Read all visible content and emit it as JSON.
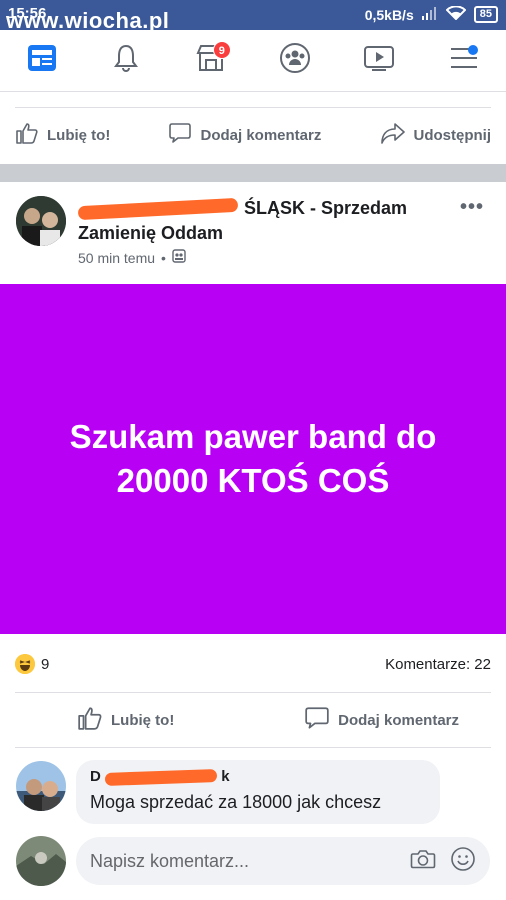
{
  "status_bar": {
    "time": "15:56",
    "network_speed": "0,5kB/s",
    "battery": "85",
    "watermark": "www.wiocha.pl"
  },
  "top_nav": {
    "items": [
      {
        "icon": "news-feed-icon",
        "active": true
      },
      {
        "icon": "bell-icon"
      },
      {
        "icon": "marketplace-icon",
        "badge": "9"
      },
      {
        "icon": "groups-icon"
      },
      {
        "icon": "video-icon"
      },
      {
        "icon": "menu-icon",
        "dot": true
      }
    ]
  },
  "top_actions": {
    "like": "Lubię to!",
    "comment": "Dodaj komentarz",
    "share": "Udostępnij"
  },
  "post": {
    "group_name": "ŚLĄSK - Sprzedam Zamienię Oddam",
    "time": "50 min temu",
    "separator": "•",
    "more": "•••",
    "text": "Szukam pawer band do 20000 KTOŚ COŚ",
    "background_color": "#b800f5"
  },
  "reactions": {
    "count": "9",
    "comments": "Komentarze: 22"
  },
  "post_actions": {
    "like": "Lubię to!",
    "comment": "Dodaj komentarz"
  },
  "comment": {
    "author_initial": "D",
    "author_suffix": "k",
    "text": "Moga sprzedać za 18000 jak chcesz"
  },
  "write_comment": {
    "placeholder": "Napisz komentarz..."
  },
  "colors": {
    "facebook_blue": "#3b5998",
    "accent_blue": "#1877f2",
    "badge_red": "#fa3e3e",
    "redaction": "#ff6a2a"
  }
}
